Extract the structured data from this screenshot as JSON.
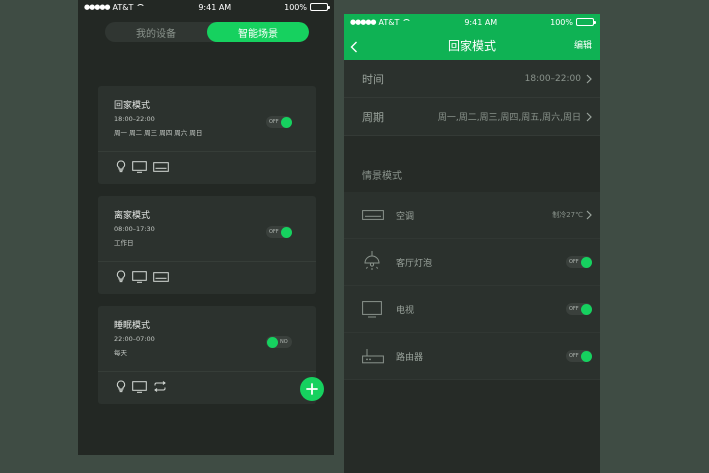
{
  "colors": {
    "accent": "#16d15f",
    "header": "#0fb254"
  },
  "status": {
    "carrier": "AT&T",
    "time": "9:41 AM",
    "battery": "100%"
  },
  "left": {
    "tabs": [
      {
        "label": "我的设备",
        "active": false
      },
      {
        "label": "智能场景",
        "active": true
      }
    ],
    "scenes": [
      {
        "title": "回家模式",
        "time": "18:00–22:00",
        "days": "周一 周二 周三 周四 周六 周日",
        "toggle": "OFF",
        "toggle_state": "off",
        "icons": [
          "bulb-icon",
          "tv-icon",
          "air-conditioner-icon"
        ]
      },
      {
        "title": "离家模式",
        "time": "08:00–17:30",
        "days": "工作日",
        "toggle": "OFF",
        "toggle_state": "off",
        "icons": [
          "bulb-icon",
          "tv-icon",
          "air-conditioner-icon"
        ]
      },
      {
        "title": "睡眠模式",
        "time": "22:00–07:00",
        "days": "每天",
        "toggle": "NO",
        "toggle_state": "on",
        "icons": [
          "bulb-icon",
          "tv-icon",
          "sync-icon"
        ]
      }
    ],
    "fab": "add-icon"
  },
  "right": {
    "nav": {
      "back": "back-icon",
      "title": "回家模式",
      "edit": "编辑"
    },
    "time_row": {
      "label": "时间",
      "value": "18:00–22:00"
    },
    "period_row": {
      "label": "周期",
      "value": "周一,周二,周三,周四,周五,周六,周日"
    },
    "section": "情景模式",
    "devices": [
      {
        "name": "空调",
        "icon": "air-conditioner-icon",
        "detail": "制冷27℃",
        "control": "chevron"
      },
      {
        "name": "客厅灯泡",
        "icon": "ceiling-lamp-icon",
        "toggle": "OFF"
      },
      {
        "name": "电视",
        "icon": "tv-icon",
        "toggle": "OFF"
      },
      {
        "name": "路由器",
        "icon": "router-icon",
        "toggle": "OFF"
      }
    ]
  }
}
